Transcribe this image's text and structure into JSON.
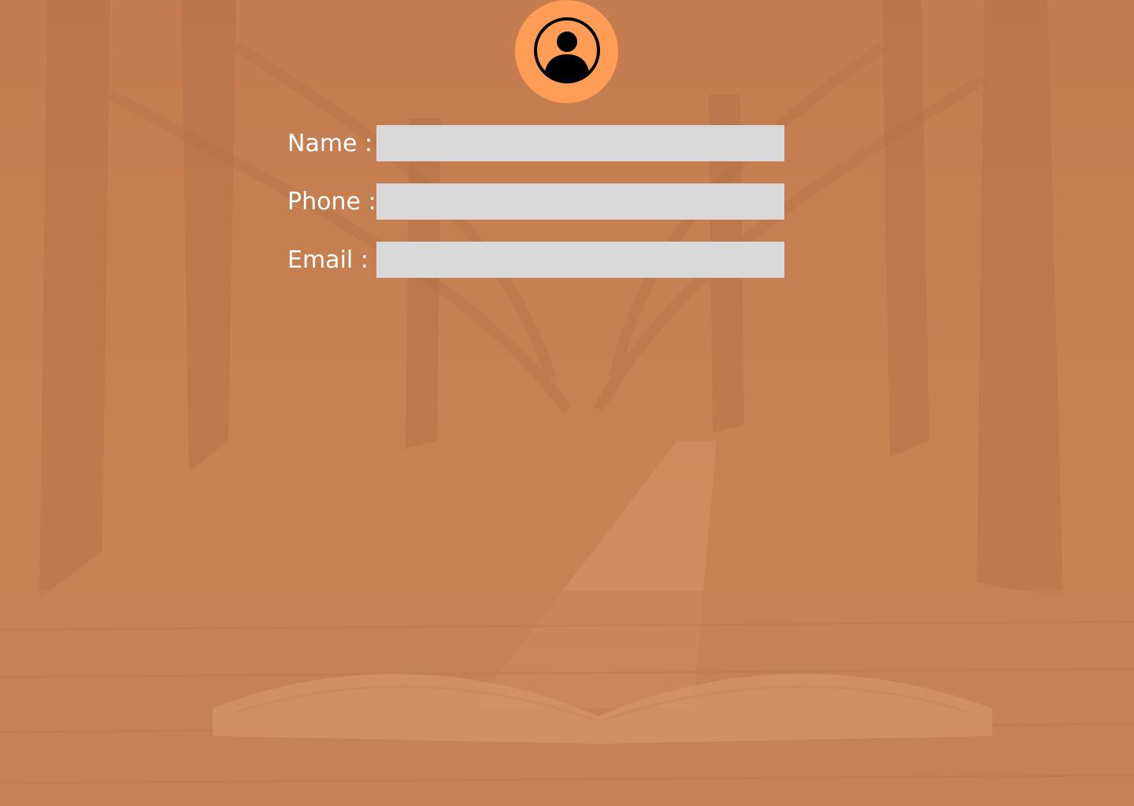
{
  "colors": {
    "background_tint": "#c98757",
    "avatar_bg": "#ff9d57",
    "input_bg": "#d9d9d9",
    "label_text": "#ffffff",
    "icon": "#000000"
  },
  "avatar": {
    "icon": "user-circle-icon"
  },
  "form": {
    "name": {
      "label": "Name :",
      "value": "",
      "placeholder": ""
    },
    "phone": {
      "label": "Phone :",
      "value": "",
      "placeholder": ""
    },
    "email": {
      "label": "Email :",
      "value": "",
      "placeholder": ""
    }
  }
}
